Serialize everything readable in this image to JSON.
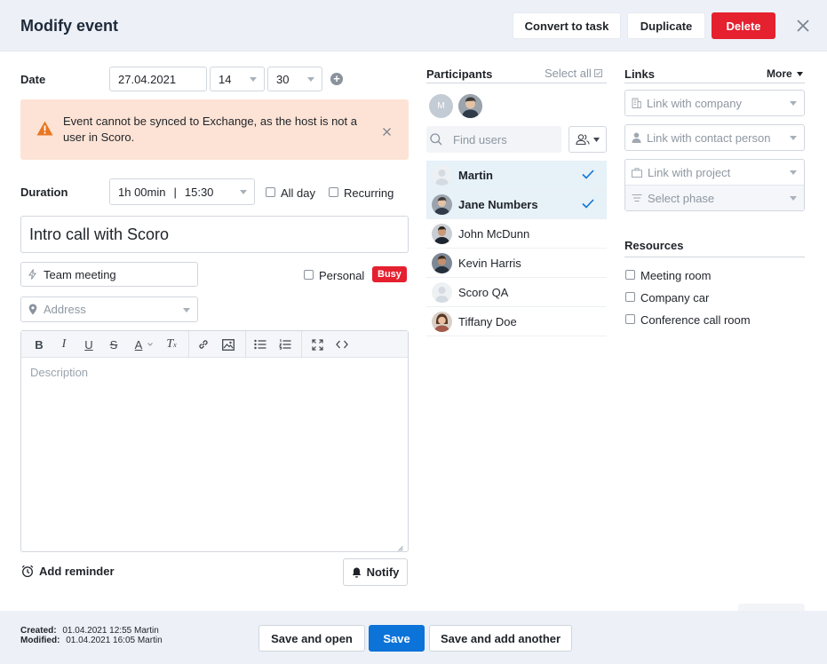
{
  "header": {
    "title": "Modify event",
    "convert_label": "Convert to task",
    "duplicate_label": "Duplicate",
    "delete_label": "Delete"
  },
  "date": {
    "label": "Date",
    "value": "27.04.2021",
    "hour": "14",
    "minute": "30"
  },
  "alert": {
    "message": "Event cannot be synced to Exchange, as the host is not a user in Scoro."
  },
  "duration": {
    "label": "Duration",
    "value": "1h 00min",
    "end_time": "15:30",
    "allday_label": "All day",
    "recurring_label": "Recurring"
  },
  "event": {
    "title": "Intro call with Scoro",
    "type": "Team meeting",
    "personal_label": "Personal",
    "busy_label": "Busy",
    "address_placeholder": "Address",
    "description_placeholder": "Description"
  },
  "editor_tools": [
    "bold-icon",
    "italic-icon",
    "underline-icon",
    "strikethrough-icon",
    "text-color-icon",
    "clear-format-icon",
    "link-icon",
    "image-icon",
    "bullet-list-icon",
    "numbered-list-icon",
    "fullscreen-icon",
    "code-icon"
  ],
  "reminder": {
    "add_label": "Add reminder",
    "notify_label": "Notify"
  },
  "participants": {
    "title": "Participants",
    "select_all": "Select all",
    "search_placeholder": "Find users",
    "avatar_initial": "M",
    "list": [
      {
        "name": "Martin",
        "selected": true
      },
      {
        "name": "Jane Numbers",
        "selected": true
      },
      {
        "name": "John McDunn",
        "selected": false
      },
      {
        "name": "Kevin Harris",
        "selected": false
      },
      {
        "name": "Scoro QA",
        "selected": false
      },
      {
        "name": "Tiffany Doe",
        "selected": false
      }
    ]
  },
  "links": {
    "title": "Links",
    "more_label": "More",
    "company_placeholder": "Link with company",
    "contact_placeholder": "Link with contact person",
    "project_placeholder": "Link with project",
    "phase_placeholder": "Select phase"
  },
  "resources": {
    "title": "Resources",
    "items": [
      "Meeting room",
      "Company car",
      "Conference call room"
    ]
  },
  "footer": {
    "created_label": "Created:",
    "created_value": "01.04.2021 12:55 Martin",
    "modified_label": "Modified:",
    "modified_value": "01.04.2021 16:05 Martin",
    "save_open_label": "Save and open",
    "save_label": "Save",
    "save_add_label": "Save and add another"
  },
  "colors": {
    "accent_blue": "#0c73d9",
    "danger_red": "#e5202f",
    "alert_bg": "#fde3d5",
    "alert_icon": "#e87722",
    "selected_row": "#e6f1f8"
  }
}
